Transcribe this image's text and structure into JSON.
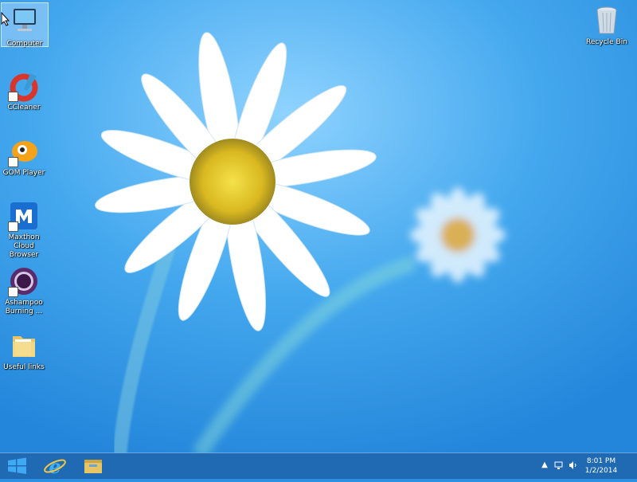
{
  "desktop": {
    "icons": [
      {
        "id": "computer",
        "label": "Computer",
        "icon": "computer-icon",
        "selected": true
      },
      {
        "id": "ccleaner",
        "label": "CCleaner",
        "icon": "ccleaner-icon",
        "shortcut": true
      },
      {
        "id": "gom",
        "label": "GOM Player",
        "icon": "gom-player-icon",
        "shortcut": true
      },
      {
        "id": "maxthon",
        "label": "Maxthon Cloud Browser",
        "icon": "maxthon-icon",
        "shortcut": true
      },
      {
        "id": "ashampoo",
        "label": "Ashampoo Burning ...",
        "icon": "ashampoo-icon",
        "shortcut": true
      },
      {
        "id": "useful",
        "label": "Useful links",
        "icon": "folder-icon"
      },
      {
        "id": "recycle",
        "label": "Recycle Bin",
        "icon": "recycle-bin-icon"
      }
    ]
  },
  "taskbar": {
    "pinned": [
      {
        "id": "start",
        "icon": "start-icon"
      },
      {
        "id": "ie",
        "icon": "internet-explorer-icon"
      },
      {
        "id": "explorer",
        "icon": "file-explorer-icon"
      }
    ],
    "tray": {
      "icons": [
        "chevron-up-icon",
        "network-icon",
        "volume-icon"
      ],
      "time": "8:01 PM",
      "date": "1/2/2014"
    }
  },
  "theme": {
    "accent": "#2a8fe0",
    "taskbar": "#195faa"
  }
}
